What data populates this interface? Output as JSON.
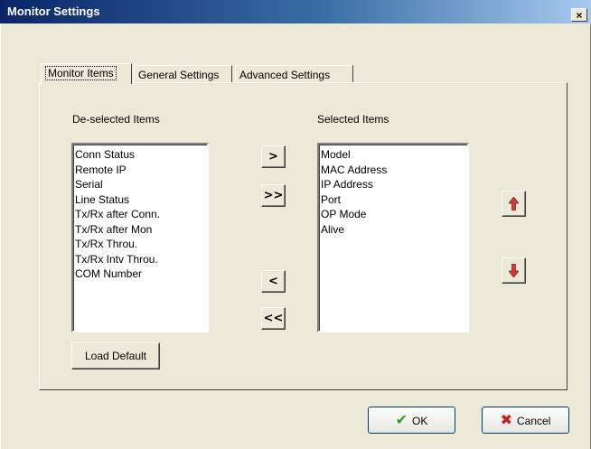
{
  "window": {
    "title": "Monitor Settings",
    "close_label": "×"
  },
  "tabs": [
    {
      "label": "Monitor Items"
    },
    {
      "label": "General Settings"
    },
    {
      "label": "Advanced Settings"
    }
  ],
  "deselected": {
    "label": "De-selected Items",
    "items": [
      "Conn Status",
      "Remote IP",
      "Serial",
      "Line Status",
      "Tx/Rx after Conn.",
      "Tx/Rx after Mon",
      "Tx/Rx Throu.",
      "Tx/Rx Intv Throu.",
      "COM Number"
    ]
  },
  "selected": {
    "label": "Selected Items",
    "items": [
      "Model",
      "MAC Address",
      "IP Address",
      "Port",
      "OP Mode",
      "Alive"
    ]
  },
  "move_buttons": {
    "add": ">",
    "add_all": ">>",
    "remove": "<",
    "remove_all": "<<"
  },
  "order_buttons": {
    "up": "🡅",
    "down": "🡇"
  },
  "load_default": "Load Default",
  "footer": {
    "ok": "OK",
    "cancel": "Cancel",
    "ok_icon": "✔",
    "cancel_icon": "✖"
  },
  "colors": {
    "title_start": "#0a246a",
    "title_end": "#a6caf0",
    "face": "#ece9d8",
    "arrow_red": "#d03a3a",
    "ok_green": "#2e9a2e",
    "cancel_red": "#c81e1e"
  }
}
